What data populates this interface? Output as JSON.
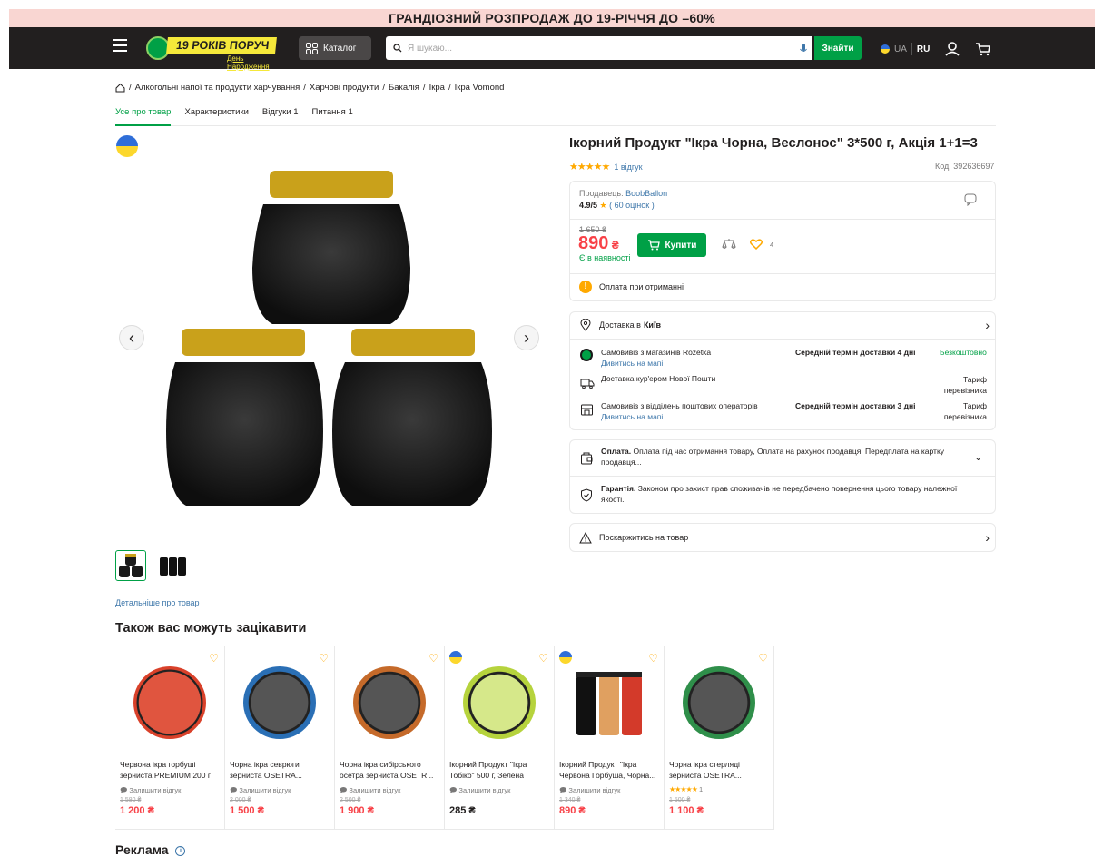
{
  "promo": {
    "text": "ГРАНДІОЗНИЙ РОЗПРОДАЖ ДО 19-РІЧЧЯ ДО –60%"
  },
  "header": {
    "logo_text": "19 РОКІВ ПОРУЧ",
    "logo_sub": "День Народження",
    "catalog_label": "Каталог",
    "search_placeholder": "Я шукаю...",
    "search_button": "Знайти",
    "lang_ua": "UA",
    "lang_ru": "RU"
  },
  "breadcrumbs": [
    "Алкогольні напої та продукти харчування",
    "Харчові продукти",
    "Бакалія",
    "Ікра",
    "Ікра Vomond"
  ],
  "tabs": [
    "Усе про товар",
    "Характеристики",
    "Відгуки 1",
    "Питання 1"
  ],
  "product": {
    "title": "Ікорний Продукт \"Ікра Чорна, Веслонос\" 3*500 г, Акція 1+1=3",
    "stars": "★★★★★",
    "reviews": "1 відгук",
    "code": "Код: 392636697",
    "seller_label": "Продавець:",
    "seller_name": "BoobBallon",
    "seller_rating": "4.9/5",
    "seller_count": "( 60 оцінок )",
    "old_price": "1 650 ₴",
    "price": "890",
    "currency": "₴",
    "buy_label": "Купити",
    "availability": "Є в наявності",
    "likes": "4",
    "payment_on_delivery": "Оплата при отриманні",
    "more_link": "Детальніше про товар"
  },
  "delivery": {
    "title_prefix": "Доставка в",
    "city": "Київ",
    "options": [
      {
        "name": "Самовивіз з магазинів Rozetka",
        "link": "Дивитись на мапі",
        "term": "Середній термін доставки 4 дні",
        "price": "Безкоштовно"
      },
      {
        "name": "Доставка кур'єром Нової Пошти",
        "link": "",
        "term": "",
        "price": "Тариф перевізника"
      },
      {
        "name": "Самовивіз з відділень поштових операторів",
        "link": "Дивитись на мапі",
        "term": "Середній термін доставки 3 дні",
        "price": "Тариф перевізника"
      }
    ]
  },
  "info": {
    "payment_bold": "Оплата.",
    "payment_text": "Оплата під час отримання товару, Оплата на рахунок продавця, Передплата на картку продавця...",
    "warranty_bold": "Гарантія.",
    "warranty_text": "Законом про захист прав споживачів не передбачено повернення цього товару належної якості.",
    "complain": "Поскаржитись на товар"
  },
  "recommend": {
    "title": "Також вас можуть зацікавити",
    "items": [
      {
        "name": "Червона ікра горбуші зерниста PREMIUM 200 г",
        "review": "Залишити відгук",
        "old": "1 580 ₴",
        "price": "1 200 ₴",
        "color": "#d9412a"
      },
      {
        "name": "Чорна ікра севрюги зерниста OSETRA...",
        "review": "Залишити відгук",
        "old": "2 000 ₴",
        "price": "1 500 ₴",
        "color": "#2a6fb5"
      },
      {
        "name": "Чорна ікра сибірського осетра зерниста OSETR...",
        "review": "Залишити відгук",
        "old": "2 500 ₴",
        "price": "1 900 ₴",
        "color": "#c56a2a"
      },
      {
        "name": "Ікорний Продукт \"Ікра Тобіко\" 500 г, Зелена",
        "review": "Залишити відгук",
        "old": "",
        "price": "285 ₴",
        "color": "#b6d33d"
      },
      {
        "name": "Ікорний Продукт \"Ікра Червона Горбуша, Чорна...",
        "review": "Залишити відгук",
        "old": "1 340 ₴",
        "price": "890 ₴",
        "color": "#e07a2a"
      },
      {
        "name": "Чорна ікра стерляді зерниста OSETRA...",
        "review": "1",
        "old": "1 500 ₴",
        "price": "1 100 ₴",
        "color": "#2f8f4a"
      }
    ]
  },
  "ad_title": "Реклама"
}
